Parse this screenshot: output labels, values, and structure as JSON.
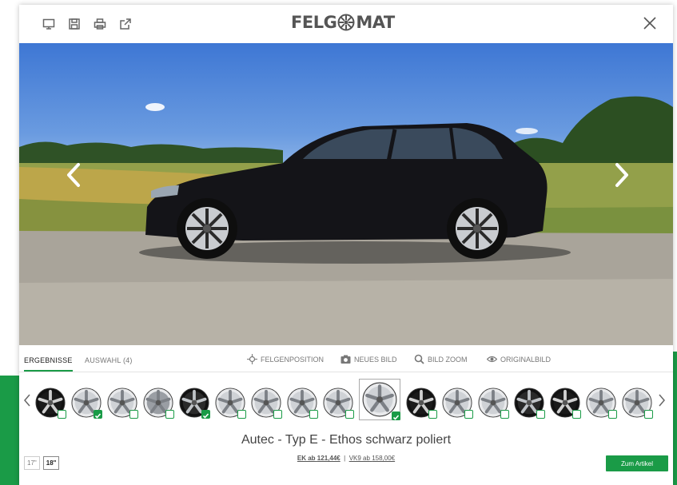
{
  "header": {
    "logo_text_left": "FELG",
    "logo_text_right": "MAT",
    "tools": [
      {
        "icon": "monitor-icon"
      },
      {
        "icon": "save-icon"
      },
      {
        "icon": "print-icon"
      },
      {
        "icon": "external-link-icon"
      }
    ],
    "close_icon": "close-icon"
  },
  "photo": {
    "prev_icon": "chevron-left-icon",
    "next_icon": "chevron-right-icon"
  },
  "tabs": {
    "results": "ERGEBNISSE",
    "selection": "AUSWAHL (4)"
  },
  "actions": {
    "position": "FELGENPOSITION",
    "new_image": "NEUES BILD",
    "zoom": "BILD ZOOM",
    "original": "ORIGINALBILD"
  },
  "colors": {
    "accent": "#1a9b47",
    "text": "#444444"
  },
  "carousel": {
    "rims": [
      {
        "style": "black",
        "check": "empty"
      },
      {
        "style": "silver",
        "check": "checked"
      },
      {
        "style": "silver",
        "check": "empty"
      },
      {
        "style": "silver-dark",
        "check": "empty"
      },
      {
        "style": "black-silver",
        "check": "checked"
      },
      {
        "style": "silver",
        "check": "empty"
      },
      {
        "style": "silver",
        "check": "empty"
      },
      {
        "style": "silver",
        "check": "empty"
      },
      {
        "style": "silver",
        "check": "empty"
      },
      {
        "style": "selected",
        "check": "checked"
      },
      {
        "style": "black",
        "check": "empty"
      },
      {
        "style": "silver",
        "check": "empty"
      },
      {
        "style": "silver",
        "check": "empty"
      },
      {
        "style": "black-silver",
        "check": "empty"
      },
      {
        "style": "black",
        "check": "empty"
      },
      {
        "style": "silver",
        "check": "empty"
      },
      {
        "style": "silver",
        "check": "empty"
      }
    ]
  },
  "product": {
    "title": "Autec - Typ E - Ethos schwarz poliert",
    "ek_label": "EK ab",
    "ek_price": "121,44€",
    "separator": "|",
    "vk_label": "VK9 ab",
    "vk_price": "158,00€"
  },
  "sizes": [
    "17\"",
    "18\""
  ],
  "cta_label": "Zum Artikel"
}
